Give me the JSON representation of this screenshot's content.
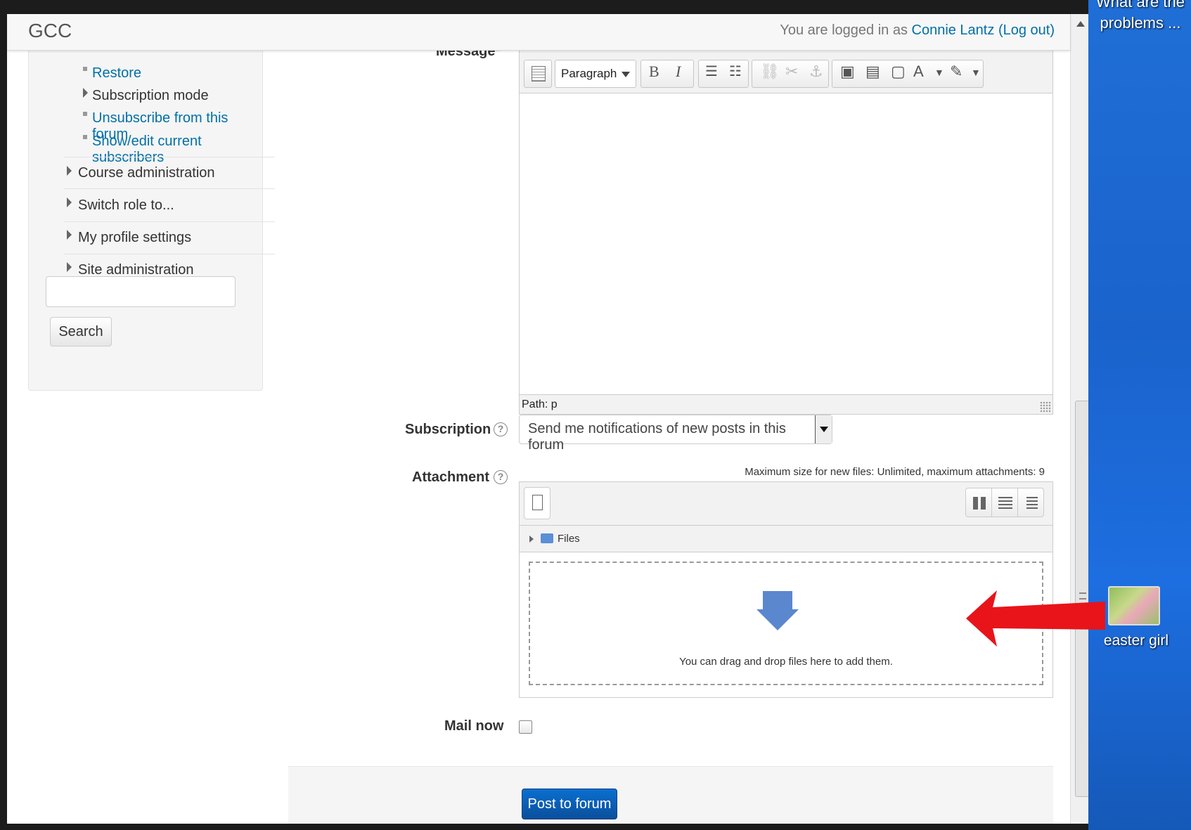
{
  "navbar": {
    "brand": "GCC",
    "login_prefix": "You are logged in as ",
    "user_name": "Connie Lantz",
    "logout": "(Log out)"
  },
  "sidebar": {
    "subitems": [
      {
        "label": "Restore",
        "link": true
      },
      {
        "label": "Subscription mode",
        "link": false
      },
      {
        "label": "Unsubscribe from this forum",
        "link": true
      },
      {
        "label": "Show/edit current subscribers",
        "link": true
      }
    ],
    "nodes": [
      {
        "label": "Course administration"
      },
      {
        "label": "Switch role to..."
      },
      {
        "label": "My profile settings"
      },
      {
        "label": "Site administration"
      }
    ],
    "search_value": "",
    "search_button": "Search"
  },
  "form": {
    "message_label": "Message",
    "editor": {
      "format": "Paragraph",
      "status": "Path: p"
    },
    "subscription_label": "Subscription",
    "subscription_value": "Send me notifications of new posts in this forum",
    "attachment_label": "Attachment",
    "max_size": "Maximum size for new files: Unlimited, maximum attachments: 9",
    "files_folder": "Files",
    "drop_text": "You can drag and drop files here to add them.",
    "mailnow_label": "Mail now",
    "mailnow_checked": false,
    "submit": "Post to forum"
  },
  "desktop": {
    "top_text_line1": "What are the",
    "top_text_line2": "problems ...",
    "icon_label": "easter girl"
  },
  "colors": {
    "link": "#0070a8",
    "primary_button": "#0a5fb5",
    "annotation_arrow": "#e8141a",
    "desktop": "#1a63cc"
  }
}
